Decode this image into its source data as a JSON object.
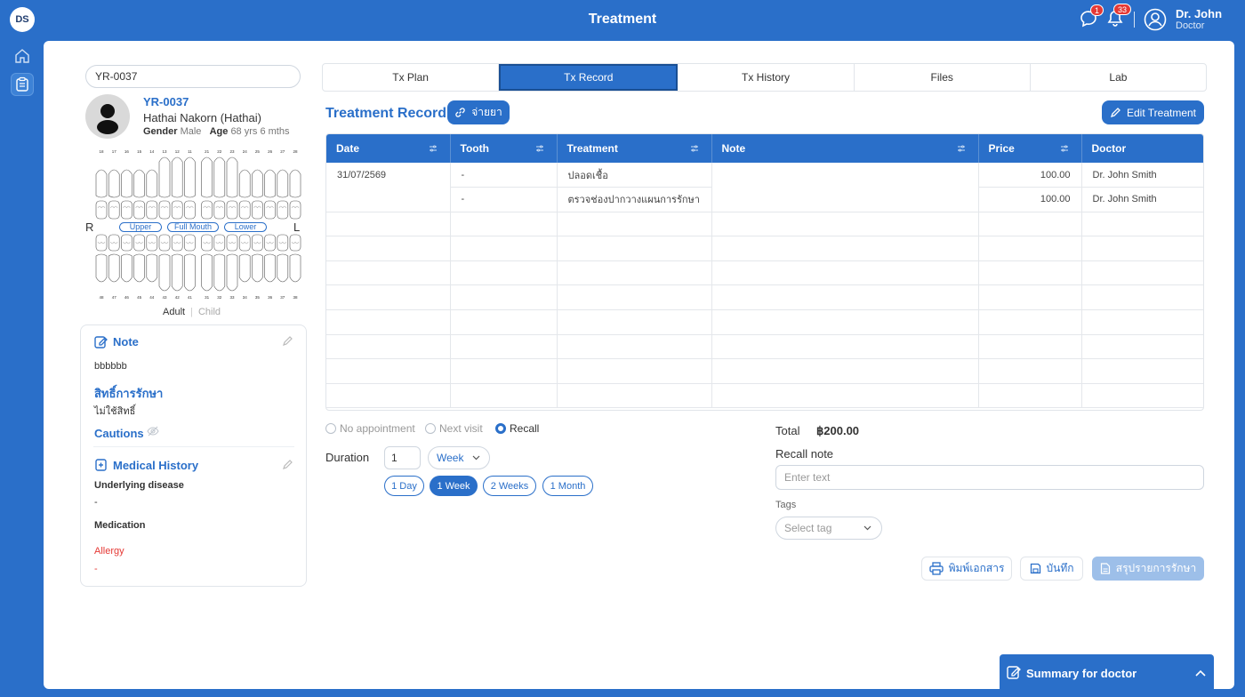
{
  "app": {
    "logo_text": "DS",
    "title": "Treatment",
    "chat_badge": "1",
    "notif_badge": "33",
    "user_name": "Dr. John",
    "user_role": "Doctor"
  },
  "patient": {
    "search_value": "YR-0037",
    "id": "YR-0037",
    "name": "Hathai Nakorn (Hathai)",
    "gender_label": "Gender",
    "gender": "Male",
    "age_label": "Age",
    "age": "68 yrs 6 mths"
  },
  "dental_chart": {
    "upper_numbers": [
      "18",
      "17",
      "16",
      "15",
      "14",
      "13",
      "12",
      "11",
      "21",
      "22",
      "23",
      "24",
      "25",
      "26",
      "27",
      "28"
    ],
    "lower_numbers": [
      "48",
      "47",
      "46",
      "45",
      "44",
      "43",
      "42",
      "41",
      "31",
      "32",
      "33",
      "34",
      "35",
      "36",
      "37",
      "38"
    ],
    "left_letter": "R",
    "right_letter": "L",
    "upper_button": "Upper",
    "full_button": "Full Mouth",
    "lower_button": "Lower",
    "adult": "Adult",
    "child": "Child"
  },
  "card": {
    "note_title": "Note",
    "note_text": "bbbbbb",
    "rights_title": "สิทธิ์การรักษา",
    "rights_text": "ไม่ใช้สิทธิ์",
    "cautions_title": "Cautions",
    "history_title": "Medical History",
    "underlying_label": "Underlying disease",
    "underlying_value": "-",
    "medication_label": "Medication",
    "allergy_label": "Allergy",
    "allergy_value": "-"
  },
  "tabs": [
    "Tx Plan",
    "Tx Record",
    "Tx History",
    "Files",
    "Lab"
  ],
  "record": {
    "title": "Treatment Record",
    "dispense_button": "จ่ายยา",
    "edit_button": "Edit Treatment",
    "columns": [
      "Date",
      "Tooth",
      "Treatment",
      "Note",
      "Price",
      "Doctor"
    ],
    "rows": [
      {
        "date": "31/07/2569",
        "tooth": "-",
        "treatment": "ปลอดเชื้อ",
        "note": "",
        "price": "100.00",
        "doctor": "Dr. John Smith"
      },
      {
        "date": "",
        "tooth": "-",
        "treatment": "ตรวจช่องปากวางแผนการรักษา",
        "note": "",
        "price": "100.00",
        "doctor": "Dr. John Smith"
      }
    ]
  },
  "appointment": {
    "options": [
      "No appointment",
      "Next visit",
      "Recall"
    ],
    "selected": "Recall",
    "duration_label": "Duration",
    "duration_value": "1",
    "duration_unit": "Week",
    "quick": [
      "1 Day",
      "1 Week",
      "2 Weeks",
      "1 Month"
    ],
    "quick_selected": "1 Week"
  },
  "summary_right": {
    "total_label": "Total",
    "total_value": "฿200.00",
    "recall_note_label": "Recall note",
    "recall_note_placeholder": "Enter text",
    "tags_label": "Tags",
    "tags_placeholder": "Select tag"
  },
  "actions": {
    "print": "พิมพ์เอกสาร",
    "save": "บันทึก",
    "summary": "สรุปรายการรักษา"
  },
  "summary_panel": {
    "title": "Summary for doctor"
  },
  "colors": {
    "primary": "#2a6fc9",
    "danger": "#e53935"
  }
}
